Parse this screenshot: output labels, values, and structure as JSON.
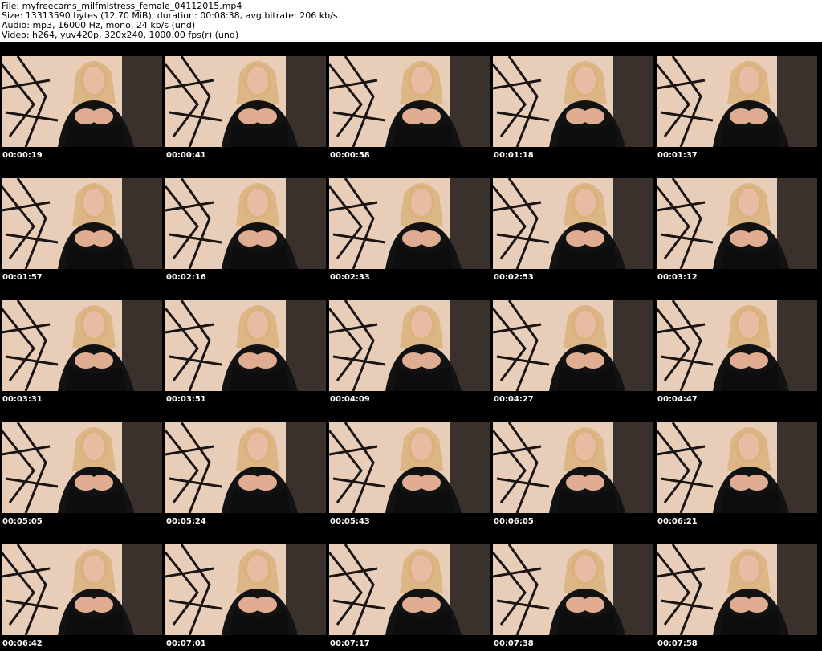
{
  "header": {
    "file_line": "File: myfreecams_milfmistress_female_04112015.mp4",
    "size_line": "Size: 13313590 bytes (12.70 MiB), duration: 00:08:38, avg.bitrate: 206 kb/s",
    "audio_line": "Audio: mp3, 16000 Hz, mono, 24 kb/s (und)",
    "video_line": "Video: h264, yuv420p, 320x240, 1000.00 fps(r) (und)"
  },
  "frames": [
    {
      "timestamp": "00:00:19"
    },
    {
      "timestamp": "00:00:41"
    },
    {
      "timestamp": "00:00:58"
    },
    {
      "timestamp": "00:01:18"
    },
    {
      "timestamp": "00:01:37"
    },
    {
      "timestamp": "00:01:57"
    },
    {
      "timestamp": "00:02:16"
    },
    {
      "timestamp": "00:02:33"
    },
    {
      "timestamp": "00:02:53"
    },
    {
      "timestamp": "00:03:12"
    },
    {
      "timestamp": "00:03:31"
    },
    {
      "timestamp": "00:03:51"
    },
    {
      "timestamp": "00:04:09"
    },
    {
      "timestamp": "00:04:27"
    },
    {
      "timestamp": "00:04:47"
    },
    {
      "timestamp": "00:05:05"
    },
    {
      "timestamp": "00:05:24"
    },
    {
      "timestamp": "00:05:43"
    },
    {
      "timestamp": "00:06:05"
    },
    {
      "timestamp": "00:06:21"
    },
    {
      "timestamp": "00:06:42"
    },
    {
      "timestamp": "00:07:01"
    },
    {
      "timestamp": "00:07:17"
    },
    {
      "timestamp": "00:07:38"
    },
    {
      "timestamp": "00:07:58"
    }
  ],
  "colors": {
    "sheet_background": "#000000",
    "header_background": "#ffffff",
    "timestamp_text": "#ffffff"
  }
}
